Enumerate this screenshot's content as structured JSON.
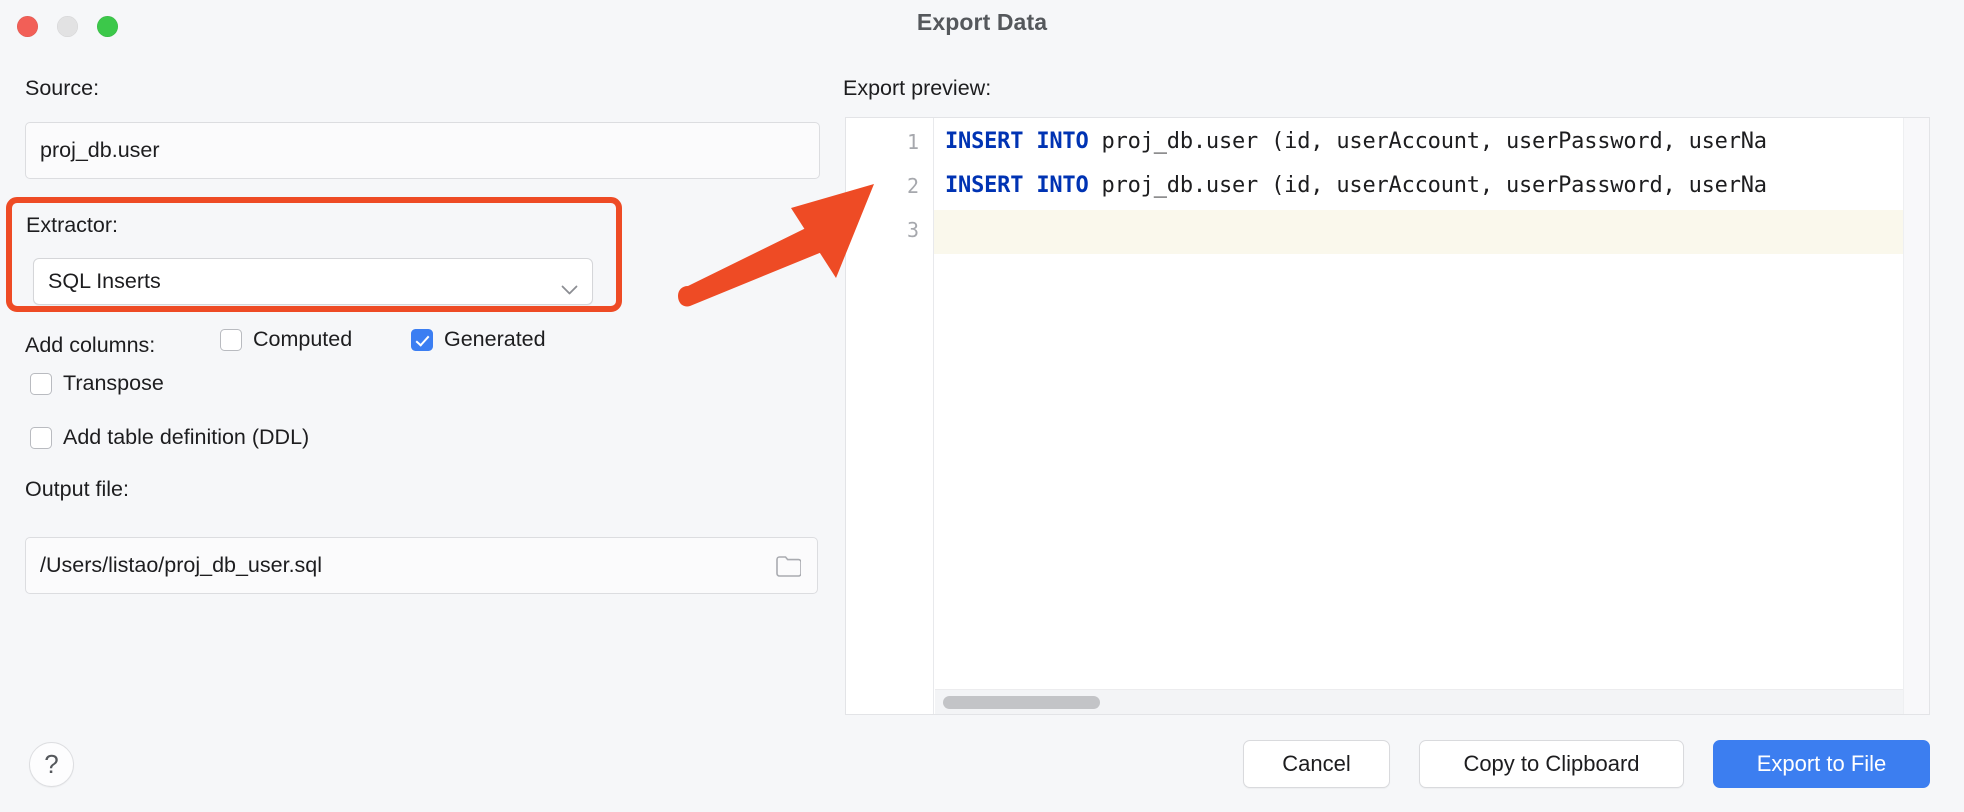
{
  "window": {
    "title": "Export Data",
    "traffic_lights": [
      {
        "name": "close",
        "color": "#f25f57"
      },
      {
        "name": "minimize",
        "color": "#e2e2e3"
      },
      {
        "name": "zoom",
        "color": "#3cc84a"
      }
    ]
  },
  "source": {
    "label": "Source:",
    "value": "proj_db.user"
  },
  "extractor": {
    "label": "Extractor:",
    "value": "SQL Inserts",
    "highlight_color": "#ee4b25",
    "chevron_icon": "chevron-down-icon"
  },
  "add_columns": {
    "label": "Add columns:",
    "options": [
      {
        "label": "Computed",
        "checked": false
      },
      {
        "label": "Generated",
        "checked": true
      }
    ]
  },
  "toggles": [
    {
      "label": "Transpose",
      "checked": false
    },
    {
      "label": "Add table definition (DDL)",
      "checked": false
    }
  ],
  "output": {
    "label": "Output file:",
    "value": "/Users/listao/proj_db_user.sql",
    "browse_icon": "folder-icon"
  },
  "preview": {
    "label": "Export preview:",
    "lines": [
      {
        "number": "1",
        "keyword": "INSERT INTO",
        "rest": " proj_db.user (id, userAccount, userPassword, userNa",
        "highlighted": false
      },
      {
        "number": "2",
        "keyword": "INSERT INTO",
        "rest": " proj_db.user (id, userAccount, userPassword, userNa",
        "highlighted": false
      },
      {
        "number": "3",
        "keyword": "",
        "rest": "",
        "highlighted": true
      }
    ],
    "keyword_color": "#0033b3",
    "current_line_color": "#faf8ec"
  },
  "annotation": {
    "type": "arrow",
    "color": "#ee4b25"
  },
  "footer": {
    "help_label": "?",
    "cancel_label": "Cancel",
    "copy_label": "Copy to Clipboard",
    "export_label": "Export to File",
    "primary_color": "#3c7ef0"
  }
}
